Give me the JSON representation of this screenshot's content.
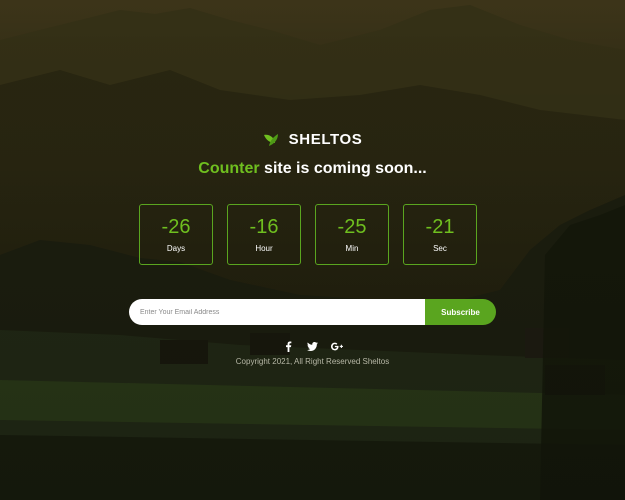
{
  "brand": {
    "name": "SHELTOS",
    "logo_icon": "leaf-icon",
    "accent_color": "#6fbf1f"
  },
  "headline": {
    "accent": "Counter",
    "rest": " site is coming soon..."
  },
  "countdown": [
    {
      "value": "-26",
      "label": "Days"
    },
    {
      "value": "-16",
      "label": "Hour"
    },
    {
      "value": "-25",
      "label": "Min"
    },
    {
      "value": "-21",
      "label": "Sec"
    }
  ],
  "subscribe": {
    "placeholder": "Enter Your Email Address",
    "button_label": "Subscribe"
  },
  "social": [
    "facebook-icon",
    "twitter-icon",
    "google-plus-icon"
  ],
  "copyright": "Copyright 2021, All Right Reserved Sheltos"
}
